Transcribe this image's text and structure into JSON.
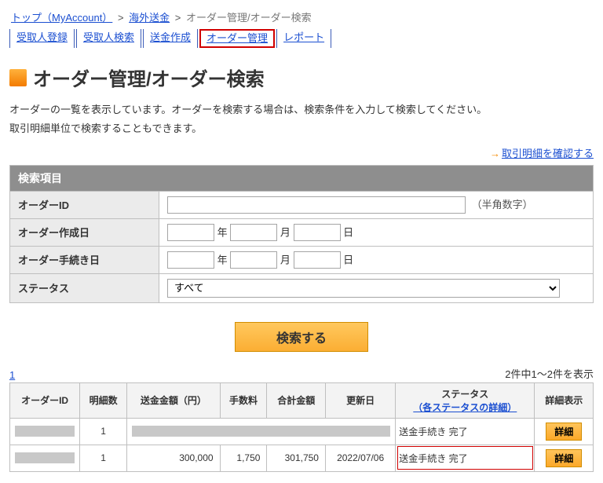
{
  "breadcrumbs": {
    "top": "トップ（MyAccount）",
    "mid": "海外送金",
    "current": "オーダー管理/オーダー検索"
  },
  "tabs": {
    "register": "受取人登録",
    "search": "受取人検索",
    "create": "送金作成",
    "manage": "オーダー管理",
    "report": "レポート"
  },
  "title": "オーダー管理/オーダー検索",
  "description1": "オーダーの一覧を表示しています。オーダーを検索する場合は、検索条件を入力して検索してください。",
  "description2": "取引明細単位で検索することもできます。",
  "confirm_link": "取引明細を確認する",
  "form": {
    "header": "検索項目",
    "order_id_label": "オーダーID",
    "order_id_hint": "（半角数字）",
    "create_date_label": "オーダー作成日",
    "proc_date_label": "オーダー手続き日",
    "status_label": "ステータス",
    "status_value": "すべて",
    "date_y": "年",
    "date_m": "月",
    "date_d": "日"
  },
  "search_button": "検索する",
  "pagination": {
    "page": "1",
    "summary": "2件中1～2件を表示"
  },
  "table": {
    "headers": {
      "order_id": "オーダーID",
      "count": "明細数",
      "amount": "送金金額（円）",
      "fee": "手数料",
      "total": "合計金額",
      "update": "更新日",
      "status": "ステータス",
      "status_link": "（各ステータスの詳細）",
      "detail": "詳細表示"
    },
    "rows": [
      {
        "order_id": " ",
        "count": "1",
        "amount": " ",
        "fee": " ",
        "total": " ",
        "update": " ",
        "status": "送金手続き 完了",
        "highlight": ""
      },
      {
        "order_id": " ",
        "count": "1",
        "amount": "300,000",
        "fee": "1,750",
        "total": "301,750",
        "update": "2022/07/06",
        "status": "送金手続き 完了",
        "highlight": "yes"
      }
    ],
    "detail_label": "詳細"
  }
}
